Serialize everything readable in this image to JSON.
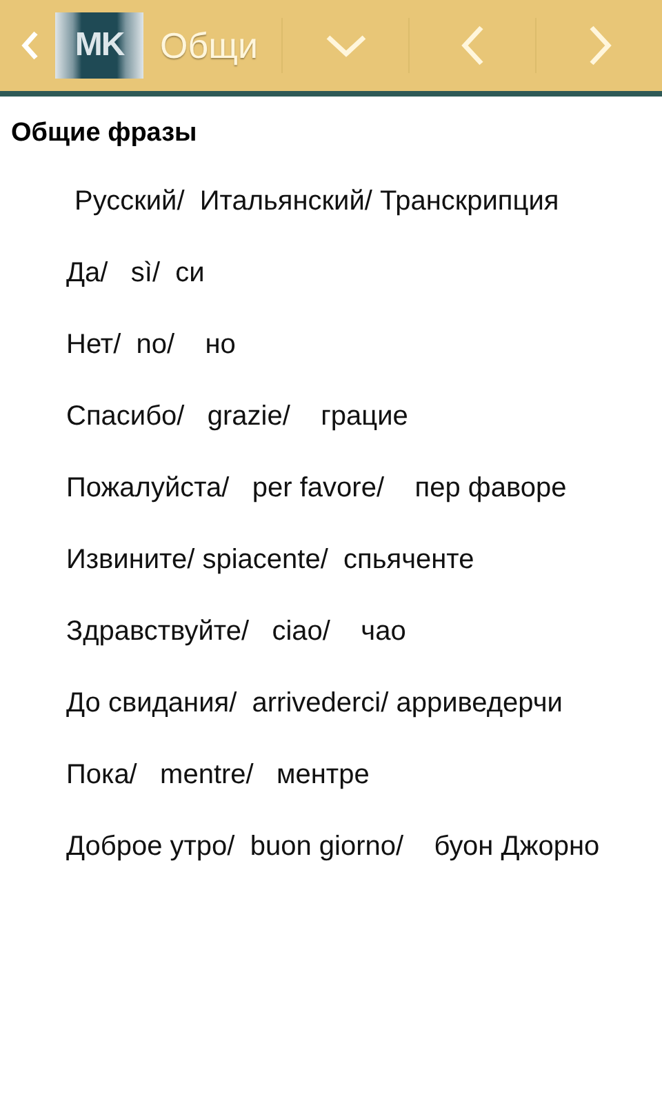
{
  "action_bar": {
    "logo_text": "MK",
    "title": "Общи"
  },
  "heading": "Общие фразы",
  "paragraphs": [
    "Русский/  Итальянский/ Транскрипция",
    "Да/   sì/  си",
    "Нет/  no/    но",
    "Спасибо/   grazie/    грацие",
    "Пожалуйста/   per favore/    пер фаворе",
    "Извините/ spiacente/  спьяченте",
    "Здравствуйте/   ciao/    чао",
    "До свидания/  arrivederci/ арриведерчи",
    "Пока/   mentre/   ментре",
    "Доброе утро/  buon giorno/    буон Джорно"
  ]
}
